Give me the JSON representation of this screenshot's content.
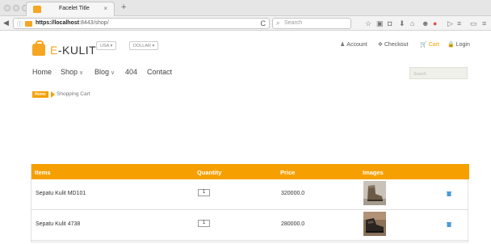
{
  "browser": {
    "tab_title": "Facelet Title",
    "tab_close": "×",
    "new_tab": "+",
    "back": "◀",
    "info": "ⓘ",
    "url_host": "https://localhost",
    "url_rest": ":8443/shop/",
    "reload": "C",
    "search_placeholder": "Search",
    "toolbar_icons": [
      "☆",
      "▣",
      "◘",
      "⬇",
      "⌂",
      "☻",
      "●",
      "▷",
      "≡",
      "▭",
      "≡"
    ]
  },
  "site": {
    "logo_e": "E",
    "logo_rest": "-KULIT",
    "country_select": "USA ▾",
    "currency_select": "DOLLAR ▾",
    "top_links": [
      {
        "icon": "♟",
        "label": "Account"
      },
      {
        "icon": "✥",
        "label": "Checkout"
      },
      {
        "icon": "🛒",
        "label": "Cart"
      },
      {
        "icon": "🔒",
        "label": "Login"
      }
    ],
    "nav": {
      "home": "Home",
      "shop": "Shop",
      "blog": "Blog",
      "page404": "404",
      "contact": "Contact",
      "chevron": "∨"
    },
    "search_placeholder": "Search",
    "breadcrumb": {
      "home": "Home",
      "current": "Shopping Cart"
    },
    "colors": {
      "accent": "#f5a000",
      "delete": "#4a9ad6"
    }
  },
  "cart": {
    "headers": {
      "items": "Items",
      "quantity": "Quantity",
      "price": "Price",
      "images": "Images"
    },
    "rows": [
      {
        "name": "Sepatu Kulit MD101",
        "quantity": "1",
        "price": "320000.0"
      },
      {
        "name": "Sepatu Kulit 4738",
        "quantity": "1",
        "price": "280000.0"
      }
    ]
  }
}
